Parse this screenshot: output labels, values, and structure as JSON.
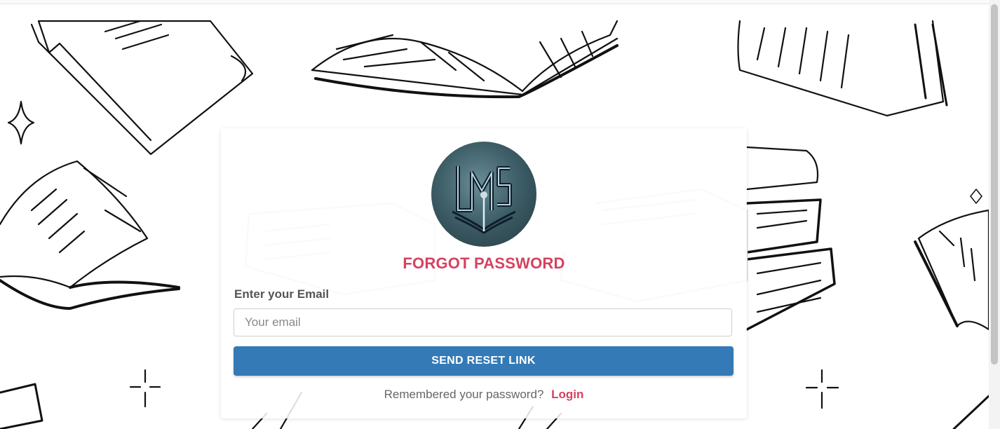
{
  "page": {
    "title": "FORGOT PASSWORD"
  },
  "logo": {
    "text": "LMS",
    "icon": "book-logo-icon"
  },
  "form": {
    "email_label": "Enter your Email",
    "email_placeholder": "Your email",
    "email_value": "",
    "submit_label": "SEND RESET LINK"
  },
  "footer": {
    "prompt": "Remembered your password?",
    "link_label": "Login"
  },
  "colors": {
    "accent": "#d6415f",
    "button": "#337ab7",
    "logo_bg": "#3f5f69"
  },
  "icons": [
    "book-doodle-icon",
    "sparkle-icon"
  ]
}
